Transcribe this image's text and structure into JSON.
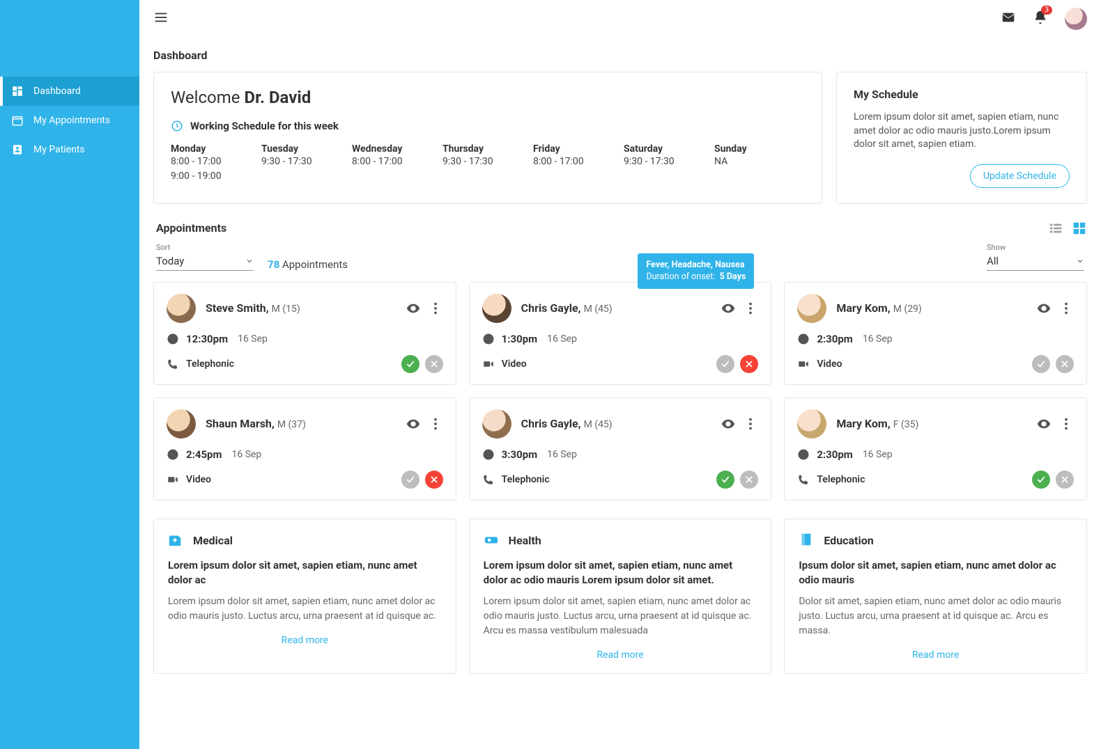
{
  "sidebar": {
    "items": [
      {
        "label": "Dashboard"
      },
      {
        "label": "My Appointments"
      },
      {
        "label": "My Patients"
      }
    ]
  },
  "header": {
    "notification_count": "3"
  },
  "page_title": "Dashboard",
  "welcome": {
    "prefix": "Welcome ",
    "name": "Dr. David",
    "schedule_heading": "Working Schedule for this week",
    "days": [
      {
        "name": "Monday",
        "t1": "8:00 - 17:00",
        "t2": "9:00 - 19:00"
      },
      {
        "name": "Tuesday",
        "t1": "9:30 - 17:30",
        "t2": ""
      },
      {
        "name": "Wednesday",
        "t1": "8:00 - 17:00",
        "t2": ""
      },
      {
        "name": "Thursday",
        "t1": "9:30 - 17:30",
        "t2": ""
      },
      {
        "name": "Friday",
        "t1": "8:00 - 17:00",
        "t2": ""
      },
      {
        "name": "Saturday",
        "t1": "9:30 - 17:30",
        "t2": ""
      },
      {
        "name": "Sunday",
        "t1": "NA",
        "t2": ""
      }
    ]
  },
  "my_schedule": {
    "title": "My Schedule",
    "desc": "Lorem ipsum dolor sit amet, sapien etiam, nunc amet dolor ac odio mauris justo.Lorem ipsum dolor sit amet, sapien etiam.",
    "button": "Update Schedule"
  },
  "appointments": {
    "title": "Appointments",
    "sort_label": "Sort",
    "sort_value": "Today",
    "show_label": "Show",
    "show_value": "All",
    "count_number": "78",
    "count_text": " Appointments",
    "tooltip": {
      "line1": "Fever, Headache, Nausea",
      "line2_label": "Duration of onset:",
      "line2_value": "5 Days"
    },
    "items": [
      {
        "name": "Steve Smith,",
        "meta": "M (15)",
        "time": "12:30pm",
        "date": "16 Sep",
        "mode": "Telephonic",
        "modeIcon": "phone",
        "accept": "green",
        "reject": "grey",
        "av": "av1"
      },
      {
        "name": "Chris Gayle,",
        "meta": "M (45)",
        "time": "1:30pm",
        "date": "16 Sep",
        "mode": "Video",
        "modeIcon": "video",
        "accept": "grey",
        "reject": "red",
        "av": "av2",
        "tooltip": true
      },
      {
        "name": "Mary Kom,",
        "meta": "M (29)",
        "time": "2:30pm",
        "date": "16 Sep",
        "mode": "Video",
        "modeIcon": "video",
        "accept": "grey",
        "reject": "grey",
        "av": "av3"
      },
      {
        "name": "Shaun Marsh,",
        "meta": "M (37)",
        "time": "2:45pm",
        "date": "16 Sep",
        "mode": "Video",
        "modeIcon": "video",
        "accept": "grey",
        "reject": "red",
        "av": "av4"
      },
      {
        "name": "Chris Gayle,",
        "meta": "M (45)",
        "time": "3:30pm",
        "date": "16 Sep",
        "mode": "Telephonic",
        "modeIcon": "phone",
        "accept": "green",
        "reject": "grey",
        "av": "av5"
      },
      {
        "name": "Mary Kom,",
        "meta": "F (35)",
        "time": "2:30pm",
        "date": "16 Sep",
        "mode": "Telephonic",
        "modeIcon": "phone",
        "accept": "green",
        "reject": "grey",
        "av": "av6"
      }
    ]
  },
  "tiles": [
    {
      "icon": "medical",
      "category": "Medical",
      "title": "Lorem ipsum dolor sit amet, sapien etiam, nunc amet dolor ac",
      "desc": "Lorem ipsum dolor sit amet, sapien etiam, nunc amet dolor ac odio mauris justo. Luctus arcu, urna praesent at id quisque ac.",
      "readmore": "Read more"
    },
    {
      "icon": "health",
      "category": "Health",
      "title": "Lorem ipsum dolor sit amet, sapien etiam, nunc amet dolor ac odio mauris Lorem ipsum dolor sit amet.",
      "desc": "Lorem ipsum dolor sit amet, sapien etiam, nunc amet dolor ac odio mauris justo. Luctus arcu, urna praesent at id quisque ac. Arcu es massa vestibulum malesuada",
      "readmore": "Read more"
    },
    {
      "icon": "education",
      "category": "Education",
      "title": "Ipsum dolor sit amet, sapien etiam, nunc amet dolor ac odio mauris",
      "desc": "Dolor sit amet, sapien etiam, nunc amet dolor ac odio mauris justo. Luctus arcu, urna praesent at id quisque ac. Arcu es massa.",
      "readmore": "Read more"
    }
  ]
}
